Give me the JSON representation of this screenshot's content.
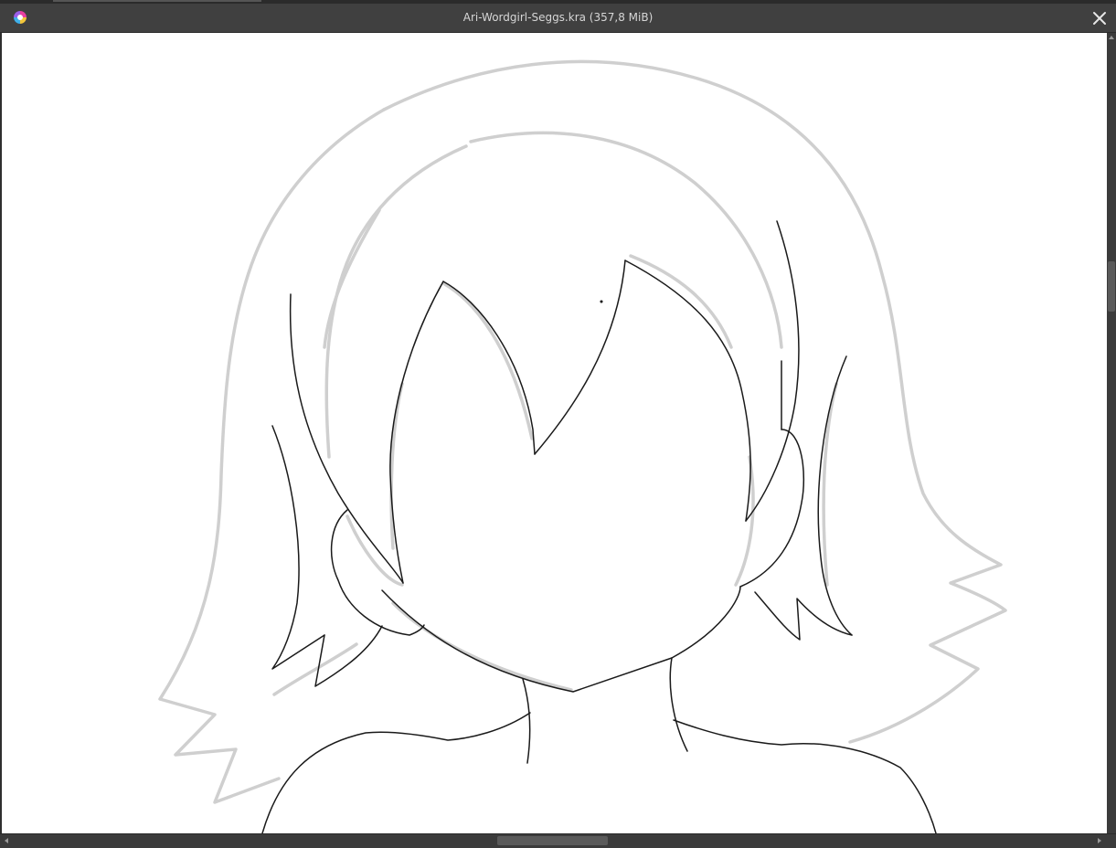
{
  "window": {
    "title": "Ari-Wordgirl-Seggs.kra (357,8 MiB)",
    "app_icon": "krita-logo-icon",
    "close_icon": "close-icon"
  },
  "colors": {
    "titlebar": "#404040",
    "canvas": "#ffffff",
    "sketch_gray": "#cfcfcf",
    "lineart": "#1a1a1a"
  },
  "scrollbars": {
    "vertical_icon": "arrow-up-icon",
    "horizontal_left_icon": "arrow-left-icon",
    "horizontal_right_icon": "arrow-right-icon"
  }
}
